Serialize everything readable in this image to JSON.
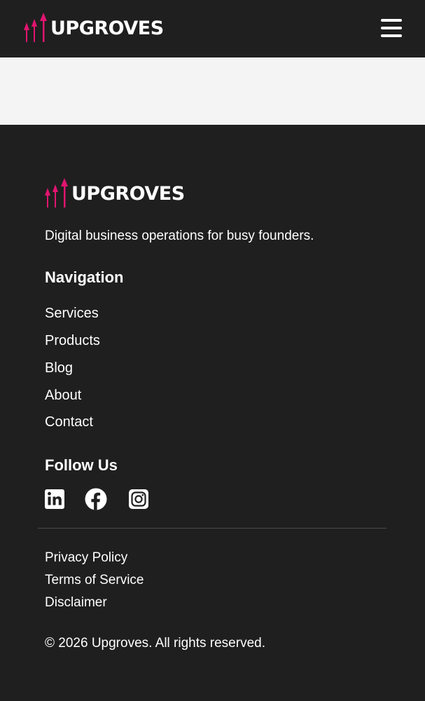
{
  "brand": {
    "name": "UPGROVES",
    "logo_icon": "upward-arrows-icon",
    "accent_color": "#e0156f"
  },
  "header": {
    "menu_icon": "hamburger-menu-icon"
  },
  "footer": {
    "tagline": "Digital business operations for busy founders.",
    "navigation": {
      "heading": "Navigation",
      "links": [
        "Services",
        "Products",
        "Blog",
        "About",
        "Contact"
      ]
    },
    "follow": {
      "heading": "Follow Us",
      "icons": [
        "linkedin-icon",
        "facebook-icon",
        "instagram-icon"
      ]
    },
    "legal": {
      "links": [
        "Privacy Policy",
        "Terms of Service",
        "Disclaimer"
      ]
    },
    "copyright": "© 2026 Upgroves. All rights reserved."
  },
  "colors": {
    "background_dark": "#1f1f1f",
    "band_light": "#f4f4f4",
    "text": "#ffffff",
    "divider": "#4a4a4a"
  }
}
